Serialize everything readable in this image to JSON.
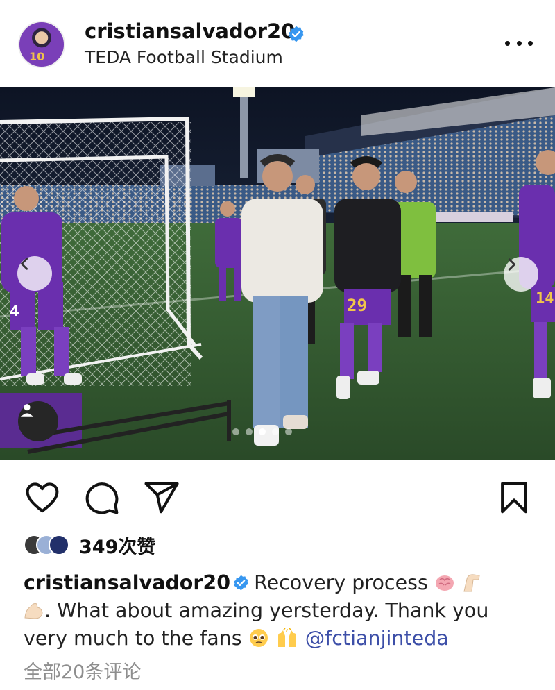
{
  "post": {
    "username": "cristiansalvador20",
    "location": "TEDA Football Stadium",
    "avatar_jersey_number": "10"
  },
  "photo": {
    "jersey_numbers": [
      "4",
      "29",
      "14"
    ],
    "carousel_dots": 4,
    "active_dot": 2
  },
  "likes": {
    "count_text": "349次赞"
  },
  "caption": {
    "username": "cristiansalvador20",
    "text_part1": "Recovery process",
    "text_part2": ". What about amazing yersterday. Thank you very much to the fans",
    "mention": "@fctianjinteda"
  },
  "comments": {
    "link_text": "全部20条评论"
  },
  "icons": {
    "verified": "verified-badge-icon",
    "more": "more-options-icon",
    "like": "heart-icon",
    "comment": "comment-bubble-icon",
    "share": "paper-plane-icon",
    "save": "bookmark-icon",
    "prev": "chevron-left-icon",
    "next": "chevron-right-icon",
    "tag": "person-tag-icon"
  },
  "colors": {
    "verified_blue": "#3797f0",
    "mention": "#3d4fa8",
    "muted": "#8e8e8e",
    "jersey_purple": "#6a2fae"
  }
}
